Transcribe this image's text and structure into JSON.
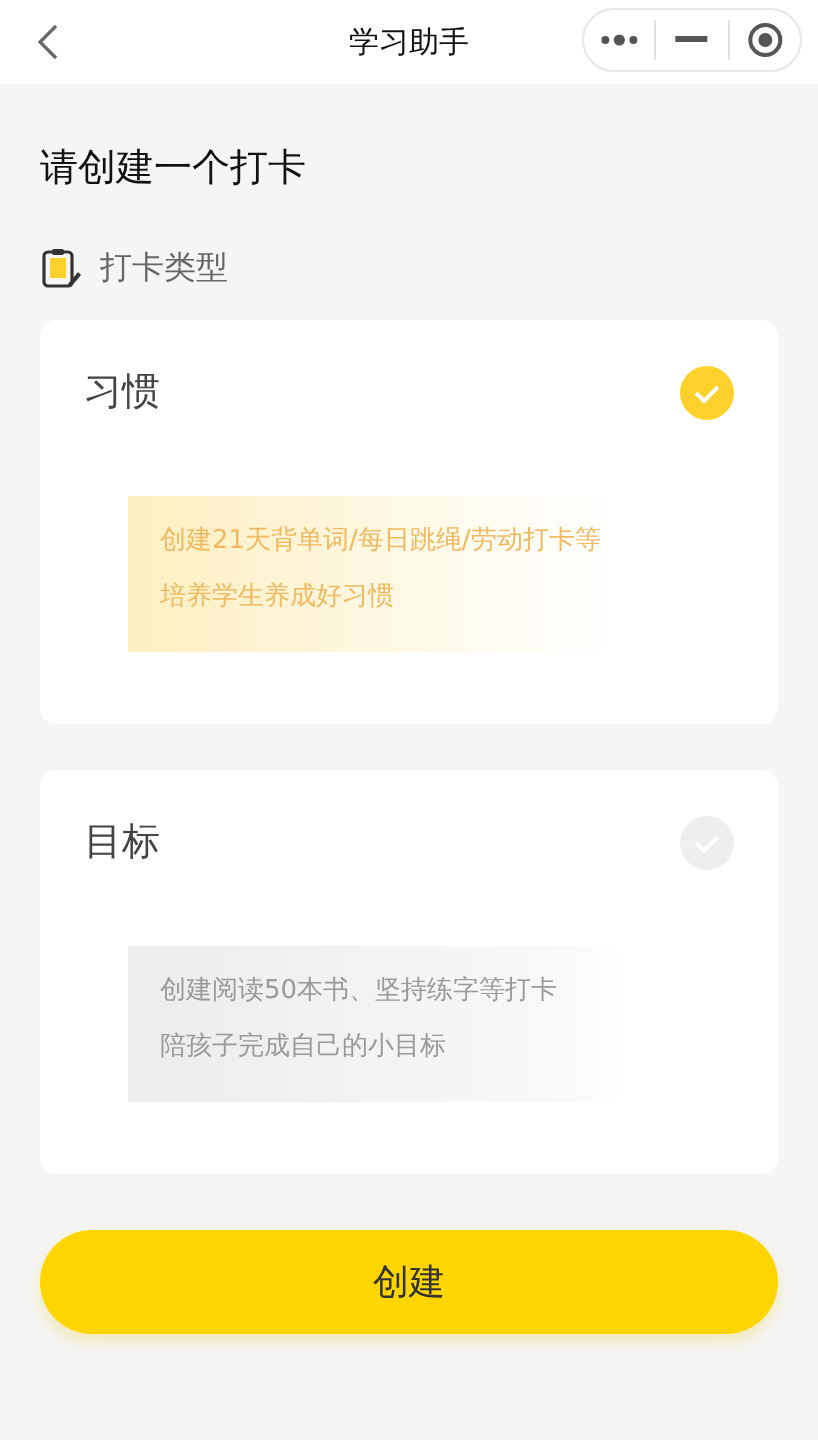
{
  "nav_bar": {
    "title": "学习助手"
  },
  "heading": "请创建一个打卡",
  "section": {
    "label": "打卡类型"
  },
  "options": [
    {
      "title": "习惯",
      "selected": true,
      "lines": [
        "创建21天背单词/每日跳绳/劳动打卡等",
        "培养学生养成好习惯"
      ]
    },
    {
      "title": "目标",
      "selected": false,
      "lines": [
        "创建阅读50本书、坚持练字等打卡",
        "陪孩子完成自己的小目标"
      ]
    }
  ],
  "button": "创建"
}
